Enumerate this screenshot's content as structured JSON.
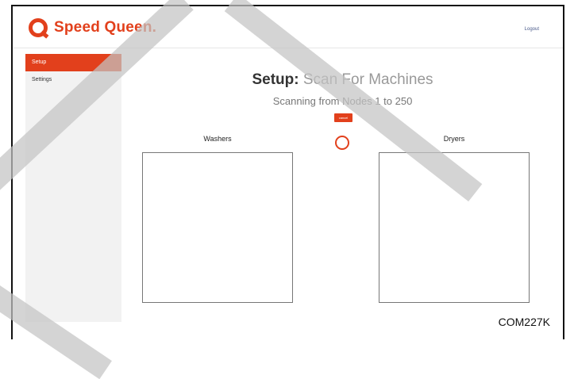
{
  "brand": {
    "name": "Speed Queen."
  },
  "header": {
    "logout_label": "Logout"
  },
  "sidebar": {
    "items": [
      {
        "label": "Setup",
        "active": true
      },
      {
        "label": "Settings",
        "active": false
      }
    ]
  },
  "main": {
    "title_bold": "Setup:",
    "title_light": "Scan For Machines",
    "subtitle": "Scanning from Nodes 1 to 250",
    "cancel_label": "cancel",
    "washers_label": "Washers",
    "dryers_label": "Dryers"
  },
  "figure_code": "COM227K",
  "colors": {
    "accent": "#e2401c",
    "sidebar_bg": "#f2f2f2",
    "watermark": "#c3c3c3"
  }
}
